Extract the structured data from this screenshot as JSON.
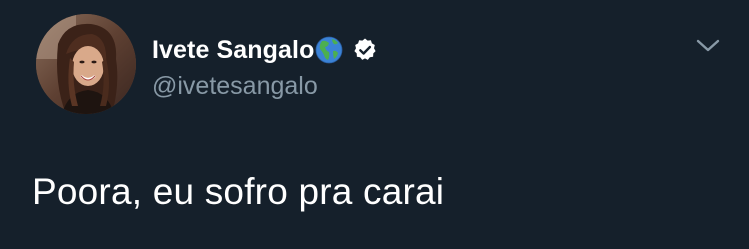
{
  "tweet": {
    "author": {
      "display_name": "Ivete Sangalo",
      "handle": "@ivetesangalo",
      "avatar_icon": "profile-photo",
      "name_emoji_icon": "globe-americas-icon",
      "verified_icon": "verified-badge-icon"
    },
    "text": "Poora, eu sofro pra carai",
    "menu_icon": "chevron-down-icon"
  },
  "colors": {
    "background": "#15202b",
    "primary_text": "#ffffff",
    "secondary_text": "#8899a6",
    "chevron": "#8899a6"
  }
}
